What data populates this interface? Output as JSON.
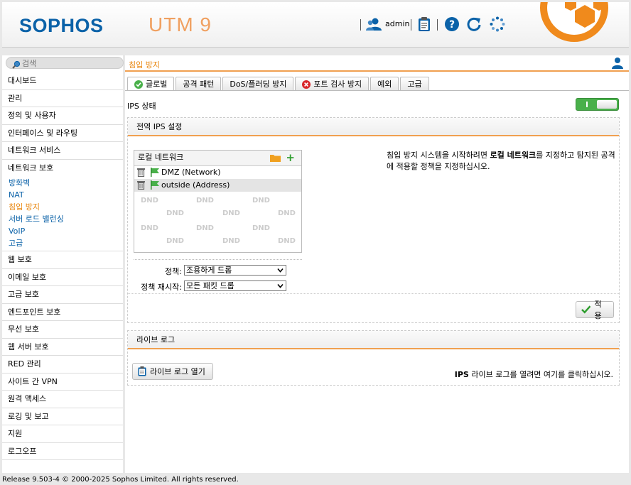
{
  "header": {
    "logo": "SOPHOS",
    "product": "UTM 9",
    "user": "admin"
  },
  "search": {
    "placeholder": "검색"
  },
  "sidebar": {
    "items_top": [
      "대시보드",
      "관리",
      "정의 및 사용자",
      "인터페이스 및 라우팅",
      "네트워크 서비스"
    ],
    "open_section": "네트워크 보호",
    "sub_items": [
      "방화벽",
      "NAT",
      "침입 방지",
      "서버 로드 밸런싱",
      "VoIP",
      "고급"
    ],
    "active_sub": "침입 방지",
    "items_bottom": [
      "웹 보호",
      "이메일 보호",
      "고급 보호",
      "엔드포인트 보호",
      "무선 보호",
      "웹 서버 보호",
      "RED 관리",
      "사이트 간 VPN",
      "원격 액세스",
      "로깅 및 보고",
      "지원",
      "로그오프"
    ]
  },
  "main": {
    "title": "침입 방지",
    "tabs": [
      {
        "label": "글로벌",
        "icon": "check-circle-icon",
        "active": true
      },
      {
        "label": "공격 패턴",
        "icon": "",
        "active": false
      },
      {
        "label": "DoS/플러딩 방지",
        "icon": "",
        "active": false
      },
      {
        "label": "포트 검사 방지",
        "icon": "error-circle-icon",
        "active": false
      },
      {
        "label": "예외",
        "icon": "",
        "active": false
      },
      {
        "label": "고급",
        "icon": "",
        "active": false
      }
    ],
    "ips_status_label": "IPS 상태",
    "ips_enabled": true,
    "global_panel": {
      "title": "전역 IPS 설정",
      "localnet_title": "로컬 네트워크",
      "networks": [
        "DMZ (Network)",
        "outside (Address)"
      ],
      "dnd": "DND",
      "info_prefix": "침입 방지 시스템을 시작하려면 ",
      "info_bold": "로컬 네트워크",
      "info_suffix": "를 지정하고 탐지된 공격에 적용할 정책을 지정하십시오.",
      "policy_label": "정책:",
      "policy_value": "조용하게 드롭",
      "policy_restart_label": "정책 재시작:",
      "policy_restart_value": "모든 패킷 드롭",
      "apply_label": "적용"
    },
    "live_panel": {
      "title": "라이브 로그",
      "open_button": "라이브 로그 열기",
      "info_bold": "IPS",
      "info_rest": " 라이브 로그를 열려면 여기를 클릭하십시오."
    }
  },
  "footer": "Release 9.503-4  © 2000-2025 Sophos Limited. All rights reserved.",
  "colors": {
    "accent": "#e8850c",
    "brand": "#0b62a8",
    "toggle_on": "#49b04a"
  }
}
